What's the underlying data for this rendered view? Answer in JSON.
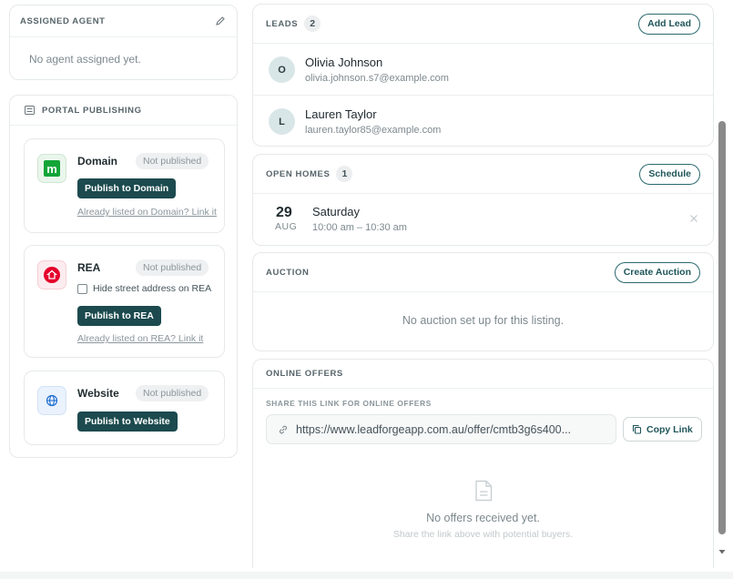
{
  "assigned_agent": {
    "title": "ASSIGNED AGENT",
    "empty_text": "No agent assigned yet."
  },
  "portal_publishing": {
    "title": "PORTAL PUBLISHING",
    "portals": [
      {
        "name": "Domain",
        "status": "Not published",
        "button": "Publish to Domain",
        "link": "Already listed on Domain? Link it",
        "icon": "domain-logo-icon",
        "color": "#13a538"
      },
      {
        "name": "REA",
        "status": "Not published",
        "checkbox_label": "Hide street address on REA",
        "button": "Publish to REA",
        "link": "Already listed on REA? Link it",
        "icon": "rea-logo-icon",
        "color": "#e4002b"
      },
      {
        "name": "Website",
        "status": "Not published",
        "button": "Publish to Website",
        "icon": "globe-icon",
        "color": "#1f6fd1"
      }
    ]
  },
  "leads": {
    "title": "LEADS",
    "count": "2",
    "add_button": "Add Lead",
    "items": [
      {
        "initial": "O",
        "name": "Olivia Johnson",
        "email": "olivia.johnson.s7@example.com"
      },
      {
        "initial": "L",
        "name": "Lauren Taylor",
        "email": "lauren.taylor85@example.com"
      }
    ]
  },
  "open_homes": {
    "title": "OPEN HOMES",
    "count": "1",
    "schedule_button": "Schedule",
    "items": [
      {
        "day": "29",
        "month": "AUG",
        "weekday": "Saturday",
        "time": "10:00 am – 10:30 am"
      }
    ]
  },
  "auction": {
    "title": "AUCTION",
    "create_button": "Create Auction",
    "empty_text": "No auction set up for this listing."
  },
  "online_offers": {
    "title": "ONLINE OFFERS",
    "share_label": "SHARE THIS LINK FOR ONLINE OFFERS",
    "link_value": "https://www.leadforgeapp.com.au/offer/cmtb3g6s400...",
    "copy_button": "Copy Link",
    "empty_title": "No offers received yet.",
    "empty_subtitle": "Share the link above with potential buyers."
  },
  "colors": {
    "accent_dark": "#1c4a4e",
    "border": "#e6e9ea"
  }
}
